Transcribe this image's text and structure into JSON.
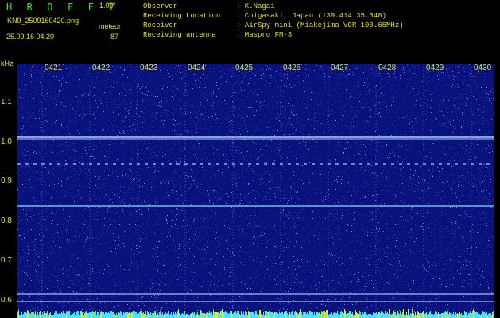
{
  "header": {
    "app_title": "H R O F F T",
    "version": "1.00f",
    "filename": "KN9_2509160420.png",
    "meteor_label": "meteor",
    "meteor_count": "87",
    "datetime": "25.09.16 04:20",
    "info": [
      {
        "label": "Observer",
        "value": ": K.Nagai"
      },
      {
        "label": "Receiving Location",
        "value": ": Chigasaki, Japan (139.414 35.340)"
      },
      {
        "label": "Receiver",
        "value": ": AirSpy mini (Miakejima VOR 108.65MHz)"
      },
      {
        "label": "Receiving antenna",
        "value": ": Maspro FM-3"
      }
    ]
  },
  "axis": {
    "y_unit": "kHz",
    "y_ticks": [
      "1.1",
      "1.0",
      "0.9",
      "0.8",
      "0.7",
      "0.6"
    ],
    "x_ticks": [
      "0421",
      "0422",
      "0423",
      "0424",
      "0425",
      "0426",
      "0427",
      "0428",
      "0429",
      "0430"
    ]
  },
  "colors": {
    "background": "#08127a",
    "text": "#e6e600",
    "title": "#33e633",
    "carrier": "#bfe8ff"
  }
}
